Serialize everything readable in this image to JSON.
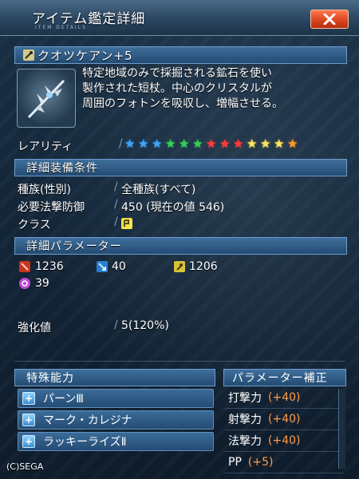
{
  "window": {
    "title": "アイテム鑑定詳細",
    "subtitle": "ITEM DETAILS"
  },
  "item": {
    "name": "クオツケアン+5",
    "description_lines": [
      "特定地域のみで採掘される鉱石を使い",
      "製作された短杖。中心のクリスタルが",
      "周囲のフォトンを吸収し、増幅させる。"
    ]
  },
  "rarity": {
    "label": "レアリティ",
    "star_colors": [
      "#3aa6ff",
      "#3aa6ff",
      "#3aa6ff",
      "#34d05a",
      "#34d05a",
      "#34d05a",
      "#ff3b3b",
      "#ff3b3b",
      "#ff3b3b",
      "#ffe65a",
      "#ffe65a",
      "#ffe65a",
      "#ff9a2a"
    ]
  },
  "equip": {
    "header": "詳細装備条件",
    "race_label": "種族(性別)",
    "race_value": "全種族(すべて)",
    "req_label": "必要法撃防御",
    "req_value": "450 (現在の値 546)",
    "class_label": "クラス",
    "class_icon": "techer-class-icon"
  },
  "params": {
    "header": "詳細パラメーター",
    "stats": [
      {
        "icon": "striking-attack-icon",
        "value": "1236"
      },
      {
        "icon": "ranged-attack-icon",
        "value": "40"
      },
      {
        "icon": "technique-attack-icon",
        "value": "1206"
      },
      {
        "icon": "element-icon",
        "value": "39"
      }
    ],
    "grind_label": "強化値",
    "grind_value": "5(120%)"
  },
  "abilities": {
    "header": "特殊能力",
    "items": [
      "パーンⅢ",
      "マーク・カレジナ",
      "ラッキーライズⅡ"
    ]
  },
  "param_bonus": {
    "header": "パラメーター補正",
    "rows": [
      {
        "label": "打撃力",
        "value": "(+40)"
      },
      {
        "label": "射撃力",
        "value": "(+40)"
      },
      {
        "label": "法撃力",
        "value": "(+40)"
      },
      {
        "label": "PP",
        "value": "(+5)"
      }
    ]
  },
  "colors": {
    "bonus_value": "#ff9b4a",
    "header_blue": "#244b72",
    "close_button": "#d9421c"
  },
  "copyright": "(C)SEGA"
}
